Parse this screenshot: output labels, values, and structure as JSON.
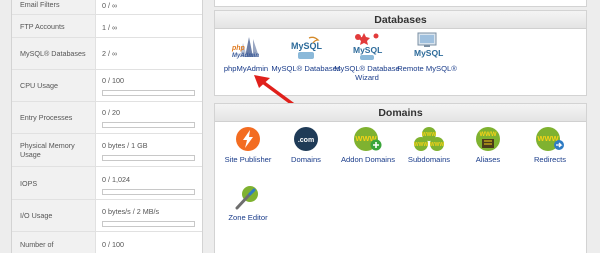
{
  "stats": [
    {
      "label": "Email Filters",
      "value": "0 / ∞",
      "bar": false
    },
    {
      "label": "FTP Accounts",
      "value": "1 / ∞",
      "bar": false
    },
    {
      "label": "MySQL® Databases",
      "value": "2 / ∞",
      "bar": false
    },
    {
      "label": "CPU Usage",
      "value": "0 / 100",
      "bar": true,
      "fill": 0
    },
    {
      "label": "Entry Processes",
      "value": "0 / 20",
      "bar": true,
      "fill": 0
    },
    {
      "label": "Physical Memory Usage",
      "value": "0 bytes / 1 GB",
      "bar": true,
      "fill": 0
    },
    {
      "label": "IOPS",
      "value": "0 / 1,024",
      "bar": true,
      "fill": 0
    },
    {
      "label": "I/O Usage",
      "value": "0 bytes/s / 2 MB/s",
      "bar": true,
      "fill": 0
    },
    {
      "label": "Number of",
      "value": "0 / 100",
      "bar": false
    }
  ],
  "databases": {
    "title": "Databases",
    "items": [
      {
        "label": "phpMyAdmin",
        "icon": "phpmyadmin-icon"
      },
      {
        "label": "MySQL® Databases",
        "icon": "mysql-databases-icon"
      },
      {
        "label": "MySQL® Database Wizard",
        "icon": "mysql-wizard-icon"
      },
      {
        "label": "Remote MySQL®",
        "icon": "remote-mysql-icon"
      }
    ]
  },
  "domains": {
    "title": "Domains",
    "items": [
      {
        "label": "Site Publisher",
        "icon": "site-publisher-icon"
      },
      {
        "label": "Domains",
        "icon": "domains-icon",
        "badge": ".com"
      },
      {
        "label": "Addon Domains",
        "icon": "addon-domains-icon",
        "badge": "WWW"
      },
      {
        "label": "Subdomains",
        "icon": "subdomains-icon",
        "badge": "WWW"
      },
      {
        "label": "Aliases",
        "icon": "aliases-icon",
        "badge": "WWW"
      },
      {
        "label": "Redirects",
        "icon": "redirects-icon",
        "badge": "WWW"
      },
      {
        "label": "Zone Editor",
        "icon": "zone-editor-icon"
      }
    ]
  },
  "colors": {
    "link": "#1a3c8a",
    "arrow": "#e0201b",
    "accent_orange": "#f36c21"
  }
}
